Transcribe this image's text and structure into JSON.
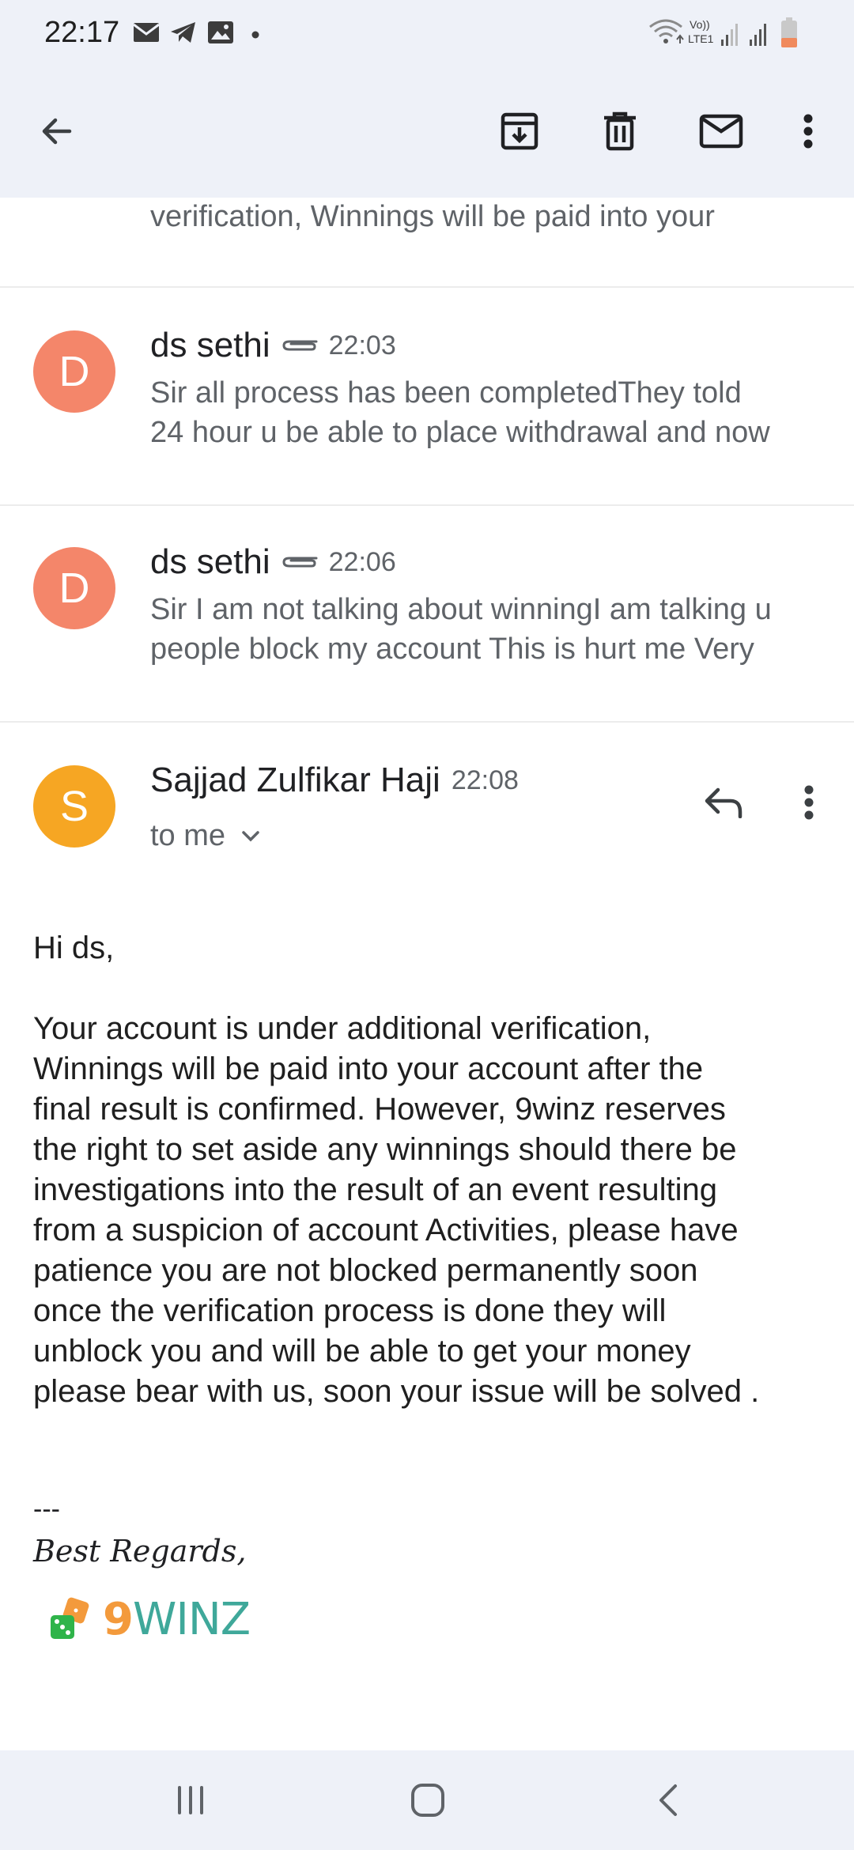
{
  "status_bar": {
    "time": "22:17",
    "left_icons": [
      "gmail-icon",
      "telegram-icon",
      "gallery-icon",
      "dot-icon"
    ],
    "right_icons": [
      "wifi-icon",
      "volte-icon",
      "signal-icon",
      "signal-icon",
      "battery-icon"
    ],
    "volte_label_top": "Vo))",
    "volte_label_bottom": "LTE1"
  },
  "toolbar": {
    "back_icon": "arrow-left-icon",
    "archive_icon": "archive-icon",
    "delete_icon": "trash-icon",
    "mark_unread_icon": "mail-icon",
    "more_icon": "more-vert-icon"
  },
  "thread": {
    "top_snippet": "verification, Winnings will be paid into your",
    "messages": [
      {
        "avatar_letter": "D",
        "avatar_color": "#f4866a",
        "sender": "ds sethi",
        "time": "22:03",
        "snippet_line1": "Sir all process has been completedThey told",
        "snippet_line2": "24 hour u be able to place withdrawal and now"
      },
      {
        "avatar_letter": "D",
        "avatar_color": "#f4866a",
        "sender": "ds sethi",
        "time": "22:06",
        "snippet_line1": "Sir I am not talking about winningI am talking u",
        "snippet_line2": "people block my account This is hurt me Very"
      }
    ],
    "open_message": {
      "avatar_letter": "S",
      "avatar_color": "#f6a623",
      "sender": "Sajjad Zulfikar Haji",
      "time": "22:08",
      "recipient": "to me",
      "greeting": "Hi ds,",
      "body_lines": [
        "Your account is under additional verification,",
        "Winnings will be paid into your account after the",
        "final result is confirmed. However, 9winz reserves",
        "the right to set aside any winnings should there be",
        "investigations into the result of an event resulting",
        "from a suspicion of account Activities, please have",
        "patience you are not blocked permanently soon",
        "once the verification process is done they will",
        "unblock you and will be able to get your money",
        "please bear with us, soon your issue will be solved ."
      ],
      "signature_separator": "---",
      "signature_regards": "Best Regards,",
      "logo_text_nine": "9",
      "logo_text_winz": "WINZ"
    }
  },
  "nav_bar": {
    "recents_icon": "recents-icon",
    "home_icon": "home-icon",
    "back_icon": "nav-back-icon"
  },
  "colors": {
    "header_bg": "#eef1f8",
    "secondary_text": "#5f6368",
    "primary_text": "#202124"
  }
}
